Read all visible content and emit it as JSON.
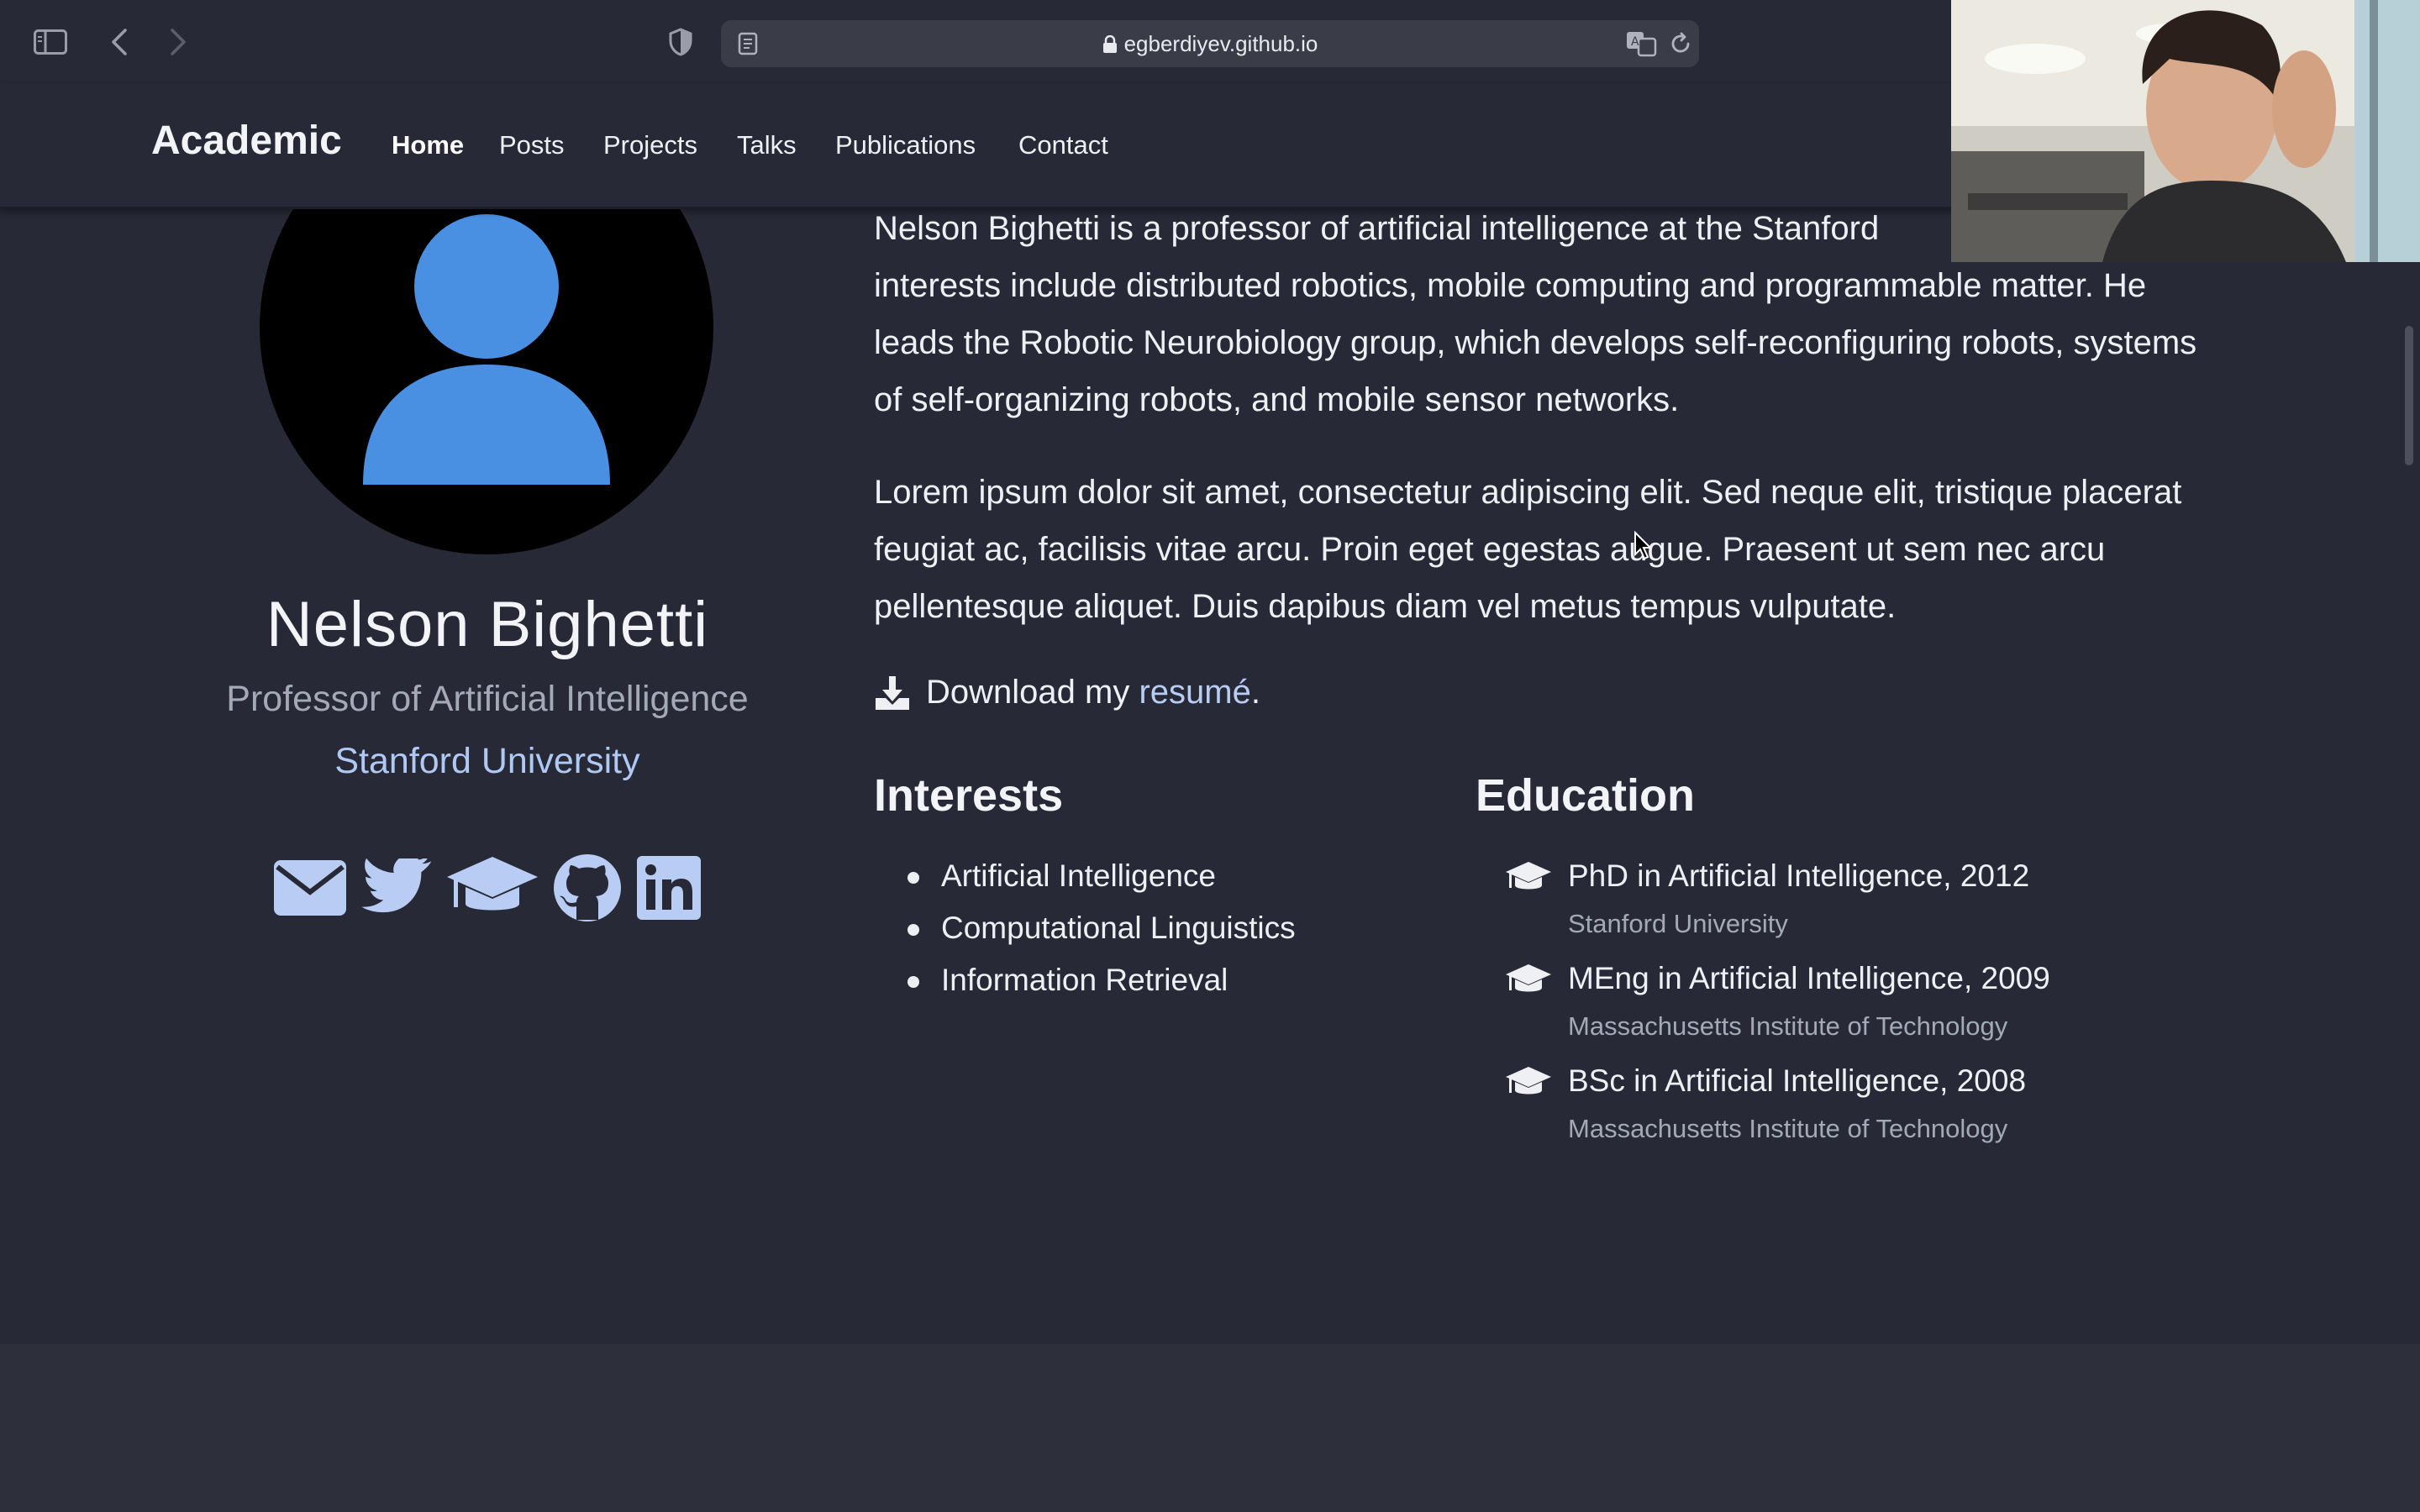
{
  "browser": {
    "url": "egberdiyev.github.io"
  },
  "nav": {
    "brand": "Academic",
    "links": [
      "Home",
      "Posts",
      "Projects",
      "Talks",
      "Publications",
      "Contact"
    ]
  },
  "profile": {
    "name": "Nelson Bighetti",
    "role": "Professor of Artificial Intelligence",
    "organization": "Stanford University",
    "social_icons": [
      "envelope-icon",
      "twitter-icon",
      "graduation-cap-icon",
      "github-icon",
      "linkedin-icon"
    ]
  },
  "bio": {
    "paragraph1_line1": "Nelson Bighetti is a professor of artificial intelligence at the Stanford",
    "paragraph1_line2": "interests include distributed robotics, mobile computing and programmable matter. He",
    "paragraph1_line3": "leads the Robotic Neurobiology group, which develops self-reconfiguring robots, systems",
    "paragraph1_line4": "of self-organizing robots, and mobile sensor networks.",
    "paragraph2_line1": "Lorem ipsum dolor sit amet, consectetur adipiscing elit. Sed neque elit, tristique placerat",
    "paragraph2_line2": "feugiat ac, facilisis vitae arcu. Proin eget egestas augue. Praesent ut sem nec arcu",
    "paragraph2_line3": "pellentesque aliquet. Duis dapibus diam vel metus tempus vulputate.",
    "download_prefix": "Download my",
    "download_link": "resumé",
    "download_suffix": "."
  },
  "interests": {
    "heading": "Interests",
    "items": [
      "Artificial Intelligence",
      "Computational Linguistics",
      "Information Retrieval"
    ]
  },
  "education": {
    "heading": "Education",
    "items": [
      {
        "degree": "PhD in Artificial Intelligence, 2012",
        "school": "Stanford University"
      },
      {
        "degree": "MEng in Artificial Intelligence, 2009",
        "school": "Massachusetts Institute of Technology"
      },
      {
        "degree": "BSc in Artificial Intelligence, 2008",
        "school": "Massachusetts Institute of Technology"
      }
    ]
  },
  "colors": {
    "background": "#272a36",
    "accent_link": "#b9cdf4",
    "avatar_blue": "#4a90e2"
  }
}
